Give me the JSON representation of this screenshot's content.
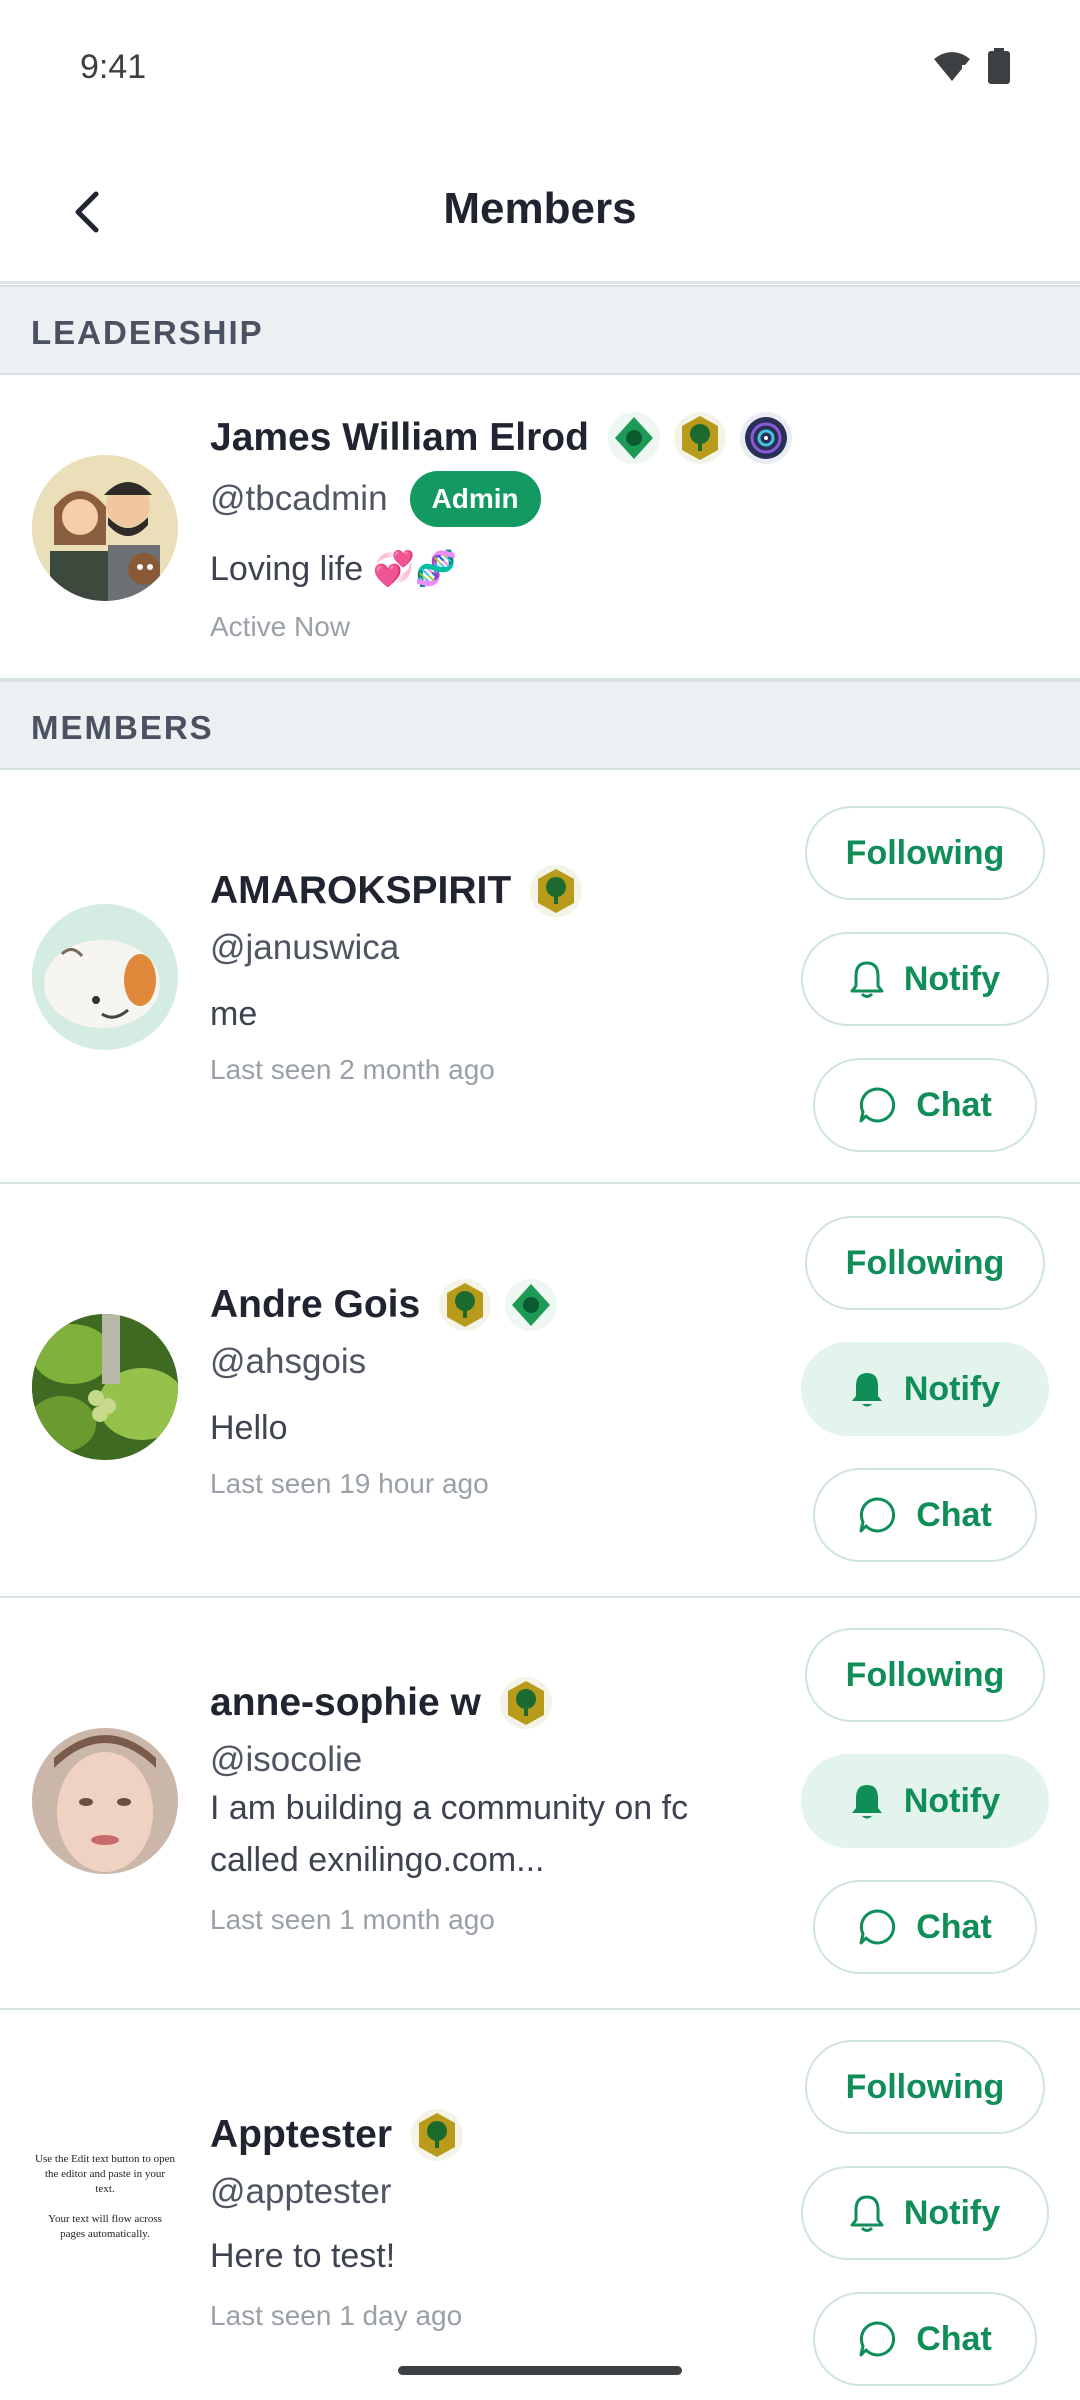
{
  "status_bar": {
    "time": "9:41"
  },
  "app_bar": {
    "title": "Members"
  },
  "sections": {
    "leadership": "LEADERSHIP",
    "members": "MEMBERS"
  },
  "leader": {
    "name": "James William Elrod",
    "handle": "@tbcadmin",
    "role_badge": "Admin",
    "bio": "Loving life 💞🧬",
    "status": "Active Now",
    "badges": [
      "green-shield-icon",
      "gold-tree-icon",
      "purple-signal-icon"
    ]
  },
  "members": [
    {
      "name": "AMAROKSPIRIT",
      "handle": "@januswica",
      "bio": "me",
      "last_seen": "Last seen 2 month ago",
      "notify_active": false,
      "badges": [
        "gold-tree-icon"
      ]
    },
    {
      "name": "Andre Gois",
      "handle": "@ahsgois",
      "bio": "Hello",
      "last_seen": "Last seen 19 hour ago",
      "notify_active": true,
      "badges": [
        "gold-tree-icon",
        "green-shield-icon"
      ]
    },
    {
      "name": "anne-sophie w",
      "handle": "@isocolie",
      "bio": "I am building a community on fc called exnilingo.com...",
      "last_seen": "Last seen 1 month ago",
      "notify_active": true,
      "badges": [
        "gold-tree-icon"
      ]
    },
    {
      "name": "Apptester",
      "handle": "@apptester",
      "bio": "Here to test!",
      "last_seen": "Last seen 1 day ago",
      "notify_active": false,
      "badges": [
        "gold-tree-icon"
      ],
      "avatar_text": "Use the Edit text button to open the editor and paste in your text.\n\nYour text will flow across pages automatically."
    }
  ],
  "buttons": {
    "following": "Following",
    "notify": "Notify",
    "chat": "Chat"
  },
  "colors": {
    "accent": "#129a62",
    "button_text": "#0f8e58",
    "section_bg": "#edf0f2"
  }
}
